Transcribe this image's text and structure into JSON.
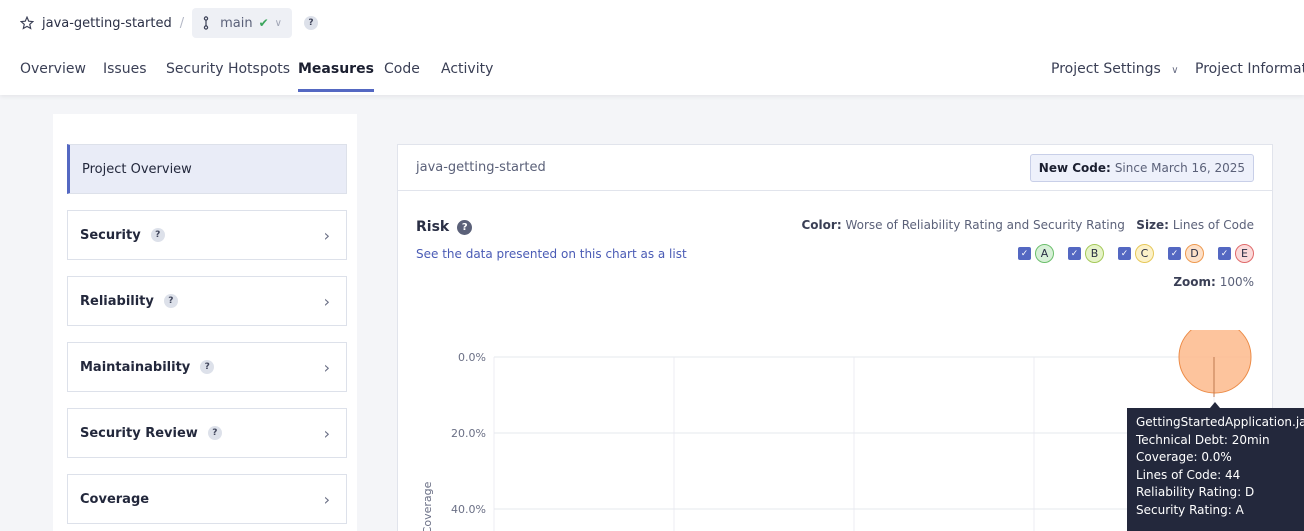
{
  "breadcrumb": {
    "project": "java-getting-started",
    "separator": "/",
    "branch": "main",
    "help": "?"
  },
  "tabs": [
    {
      "label": "Overview"
    },
    {
      "label": "Issues"
    },
    {
      "label": "Security Hotspots"
    },
    {
      "label": "Measures"
    },
    {
      "label": "Code"
    },
    {
      "label": "Activity"
    },
    {
      "label": "Project Settings"
    },
    {
      "label": "Project Information"
    }
  ],
  "sidebar": {
    "items": [
      {
        "label": "Project Overview"
      },
      {
        "label": "Security",
        "help": "?"
      },
      {
        "label": "Reliability",
        "help": "?"
      },
      {
        "label": "Maintainability",
        "help": "?"
      },
      {
        "label": "Security Review",
        "help": "?"
      },
      {
        "label": "Coverage"
      }
    ]
  },
  "main": {
    "project": "java-getting-started",
    "new_code_label": "New Code:",
    "new_code_value": "Since March 16, 2025",
    "risk_title": "Risk",
    "risk_help": "?",
    "see_link": "See the data presented on this chart as a list",
    "color_label": "Color:",
    "color_value": "Worse of Reliability Rating and Security Rating",
    "size_label": "Size:",
    "size_value": "Lines of Code",
    "zoom_label": "Zoom:",
    "zoom_value": "100%",
    "ratings": [
      {
        "letter": "A",
        "color": "#d7f0d7",
        "border": "#6cbf6c"
      },
      {
        "letter": "B",
        "color": "#e6f3c8",
        "border": "#a5c95a"
      },
      {
        "letter": "C",
        "color": "#fcf1c8",
        "border": "#e6c85a"
      },
      {
        "letter": "D",
        "color": "#fde0c8",
        "border": "#ee9a50"
      },
      {
        "letter": "E",
        "color": "#fbdada",
        "border": "#e06a6a"
      }
    ]
  },
  "chart_data": {
    "type": "scatter",
    "ylabel": "Coverage",
    "y_ticks": [
      "0.0%",
      "20.0%",
      "40.0%"
    ],
    "points": [
      {
        "name": "GettingStartedApplication.java",
        "technical_debt": "20min",
        "coverage": 0.0,
        "lines_of_code": 44,
        "reliability_rating": "D",
        "security_rating": "A",
        "color": "#fdba8c"
      }
    ]
  },
  "tooltip": {
    "file": "GettingStartedApplication.java",
    "debt": "Technical Debt: 20min",
    "coverage": "Coverage: 0.0%",
    "loc": "Lines of Code: 44",
    "reliability": "Reliability Rating: D",
    "security": "Security Rating: A"
  }
}
